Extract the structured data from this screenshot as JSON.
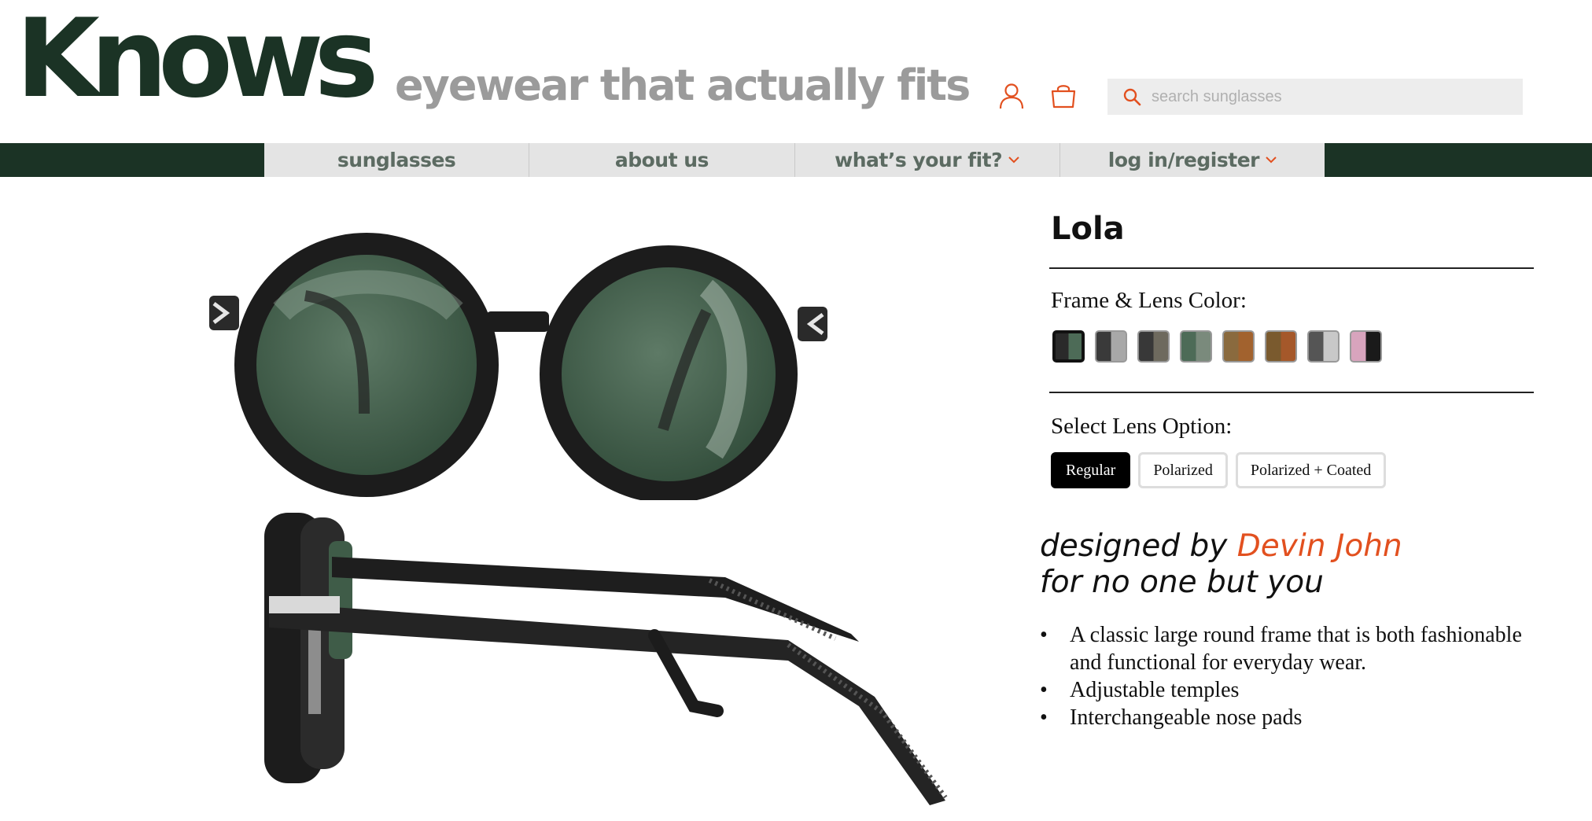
{
  "brand": {
    "logo": "Knows",
    "tagline": "eyewear that actually fits"
  },
  "header": {
    "icons": [
      "user-icon",
      "shopping-bag-icon",
      "search-icon"
    ],
    "search_placeholder": "search sunglasses"
  },
  "nav": {
    "items": [
      {
        "label": "sunglasses",
        "dropdown": false
      },
      {
        "label": "about us",
        "dropdown": false
      },
      {
        "label": "what’s your fit?",
        "dropdown": true
      },
      {
        "label": "log in/register",
        "dropdown": true
      }
    ]
  },
  "product": {
    "name": "Lola",
    "color_label": "Frame & Lens Color:",
    "colors": [
      {
        "frame": "#2a2a2a",
        "lens": "#4d6b57",
        "selected": true
      },
      {
        "frame": "#3a3a3a",
        "lens": "#a8a8a8",
        "selected": false
      },
      {
        "frame": "#383838",
        "lens": "#6e6a5e",
        "selected": false
      },
      {
        "frame": "#4d6b57",
        "lens": "#7a8a7c",
        "selected": false
      },
      {
        "frame": "#8a6a3e",
        "lens": "#a2622e",
        "selected": false
      },
      {
        "frame": "#7a5a2e",
        "lens": "#a5582a",
        "selected": false
      },
      {
        "frame": "#555555",
        "lens": "#c8c8c8",
        "selected": false
      },
      {
        "frame": "#d8a4bd",
        "lens": "#1a1a1a",
        "selected": false
      }
    ],
    "lens_label": "Select Lens Option:",
    "lens_options": [
      {
        "label": "Regular",
        "selected": true
      },
      {
        "label": "Polarized",
        "selected": false
      },
      {
        "label": "Polarized + Coated",
        "selected": false
      }
    ],
    "designed_prefix": "designed by",
    "designer": "Devin John",
    "designed_suffix": "for no one but you",
    "features": [
      "A classic large round frame that is both fashionable and functional for everyday wear.",
      "Adjustable temples",
      "Interchangeable nose pads"
    ]
  },
  "colors": {
    "brand_green": "#1b3325",
    "accent": "#e2501f",
    "tagline_gray": "#9b9b9b",
    "nav_bg": "#e4e4e4"
  }
}
